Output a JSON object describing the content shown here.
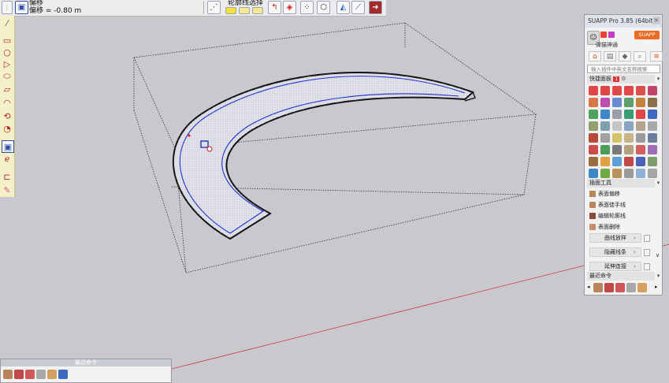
{
  "toolbar": {
    "status_title": "偏移",
    "status_offset": "偏移 = -0.80 m",
    "contour_label": "轮廓线选择"
  },
  "panel": {
    "title": "SUAPP Pro 3.85 (64bit)",
    "user_name": "弹猫神通",
    "pro_button": "SUAPP 3.85",
    "search_placeholder": "输入插件中英文名称搜索",
    "quick_section": "快捷面板",
    "quick_badge": "1",
    "face_tools_section": "插面工具",
    "list_items": [
      "表面偏移",
      "表面徒手线",
      "编辑轮廓线",
      "表面删除"
    ],
    "sub_buttons": [
      "曲线放样",
      "隐藏线条",
      "延伸连接"
    ],
    "recent_section": "最近命令"
  },
  "recent_mini": {
    "title": "最近命令"
  },
  "colors": {
    "viewport_bg": "#c9c9cd",
    "left_toolbar_bg": "#f4f1c9",
    "accent_orange": "#ee6b24",
    "ring_edge": "#2233cc",
    "axis_red": "#c8485a"
  }
}
